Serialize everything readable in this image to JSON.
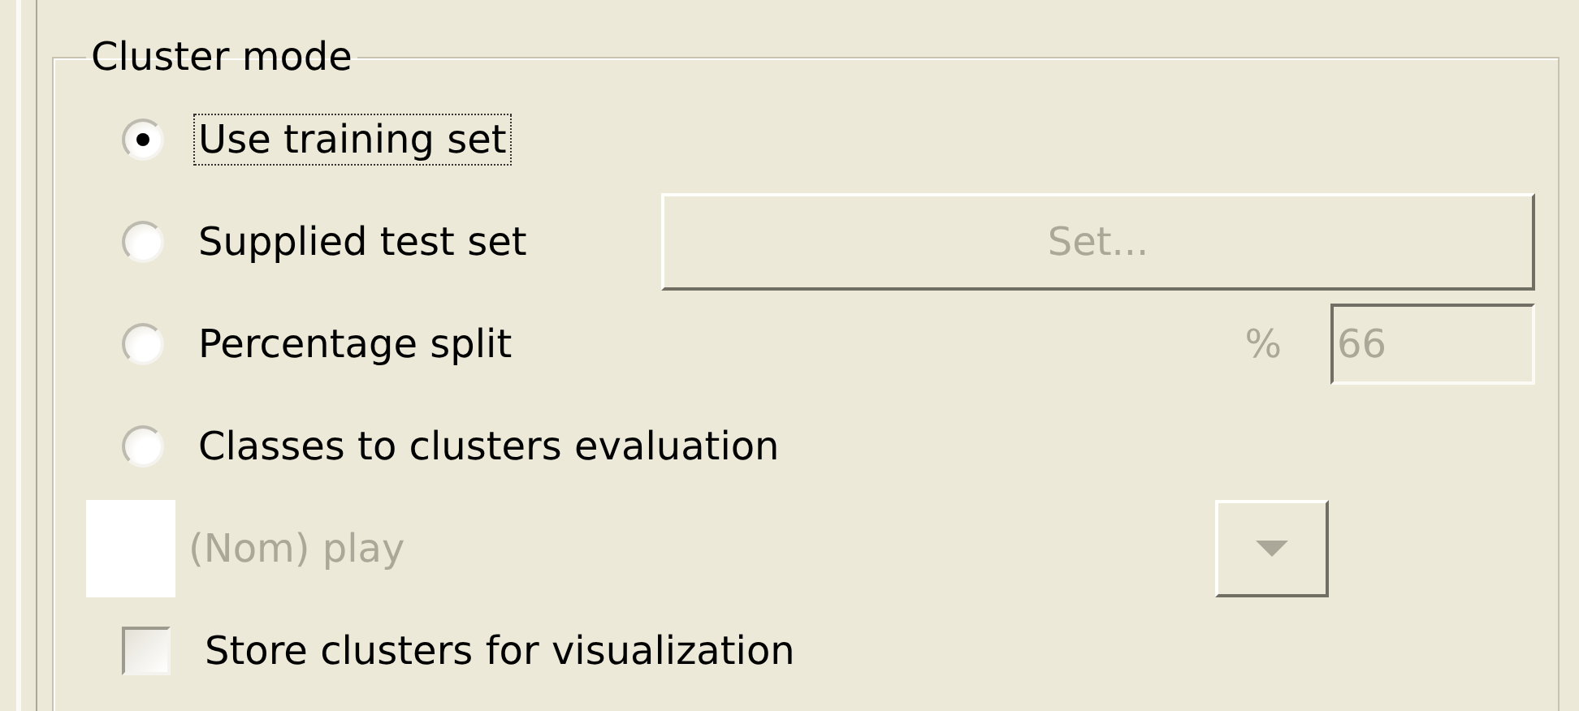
{
  "group": {
    "title": "Cluster mode"
  },
  "modes": [
    {
      "label": "Use training set",
      "selected": true,
      "focused": true
    },
    {
      "label": "Supplied test set",
      "selected": false,
      "focused": false
    },
    {
      "label": "Percentage split",
      "selected": false,
      "focused": false
    },
    {
      "label": "Classes to clusters evaluation",
      "selected": false,
      "focused": false
    }
  ],
  "test_set_button": {
    "label": "Set...",
    "disabled": true
  },
  "split": {
    "symbol": "%",
    "value": "66",
    "disabled": true
  },
  "class_select": {
    "value": "(Nom) play",
    "disabled": true
  },
  "store_clusters": {
    "label": "Store clusters for visualization",
    "checked": false
  }
}
